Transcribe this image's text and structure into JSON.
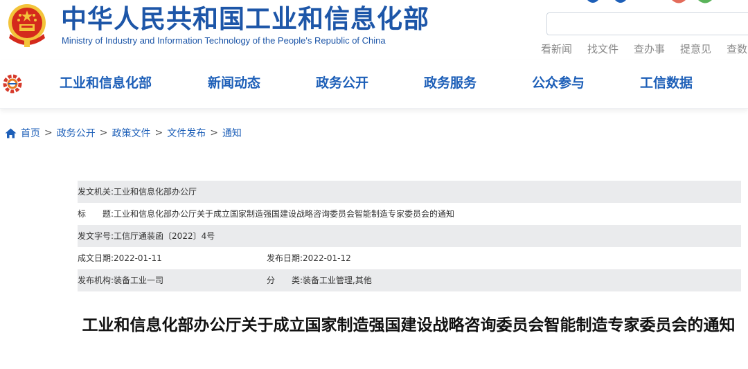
{
  "header": {
    "title_cn": "中华人民共和国工业和信息化部",
    "title_en": "Ministry of Industry and Information Technology of the People's Republic of China",
    "quick_links": [
      "看新闻",
      "找文件",
      "查办事",
      "提意见",
      "查数"
    ]
  },
  "nav": {
    "items": [
      "工业和信息化部",
      "新闻动态",
      "政务公开",
      "政务服务",
      "公众参与",
      "工信数据"
    ]
  },
  "breadcrumb": [
    "首页",
    "政务公开",
    "政策文件",
    "文件发布",
    "通知"
  ],
  "info": {
    "issuer_label": "发文机关:",
    "issuer": "工业和信息化部办公厅",
    "subject_label": "标　　题:",
    "subject": "工业和信息化部办公厅关于成立国家制造强国建设战略咨询委员会智能制造专家委员会的通知",
    "doc_no_label": "发文字号:",
    "doc_no": "工信厅通装函〔2022〕4号",
    "written_label": "成文日期:",
    "written": "2022-01-11",
    "published_label": "发布日期:",
    "published": "2022-01-12",
    "agency_label": "发布机构:",
    "agency": "装备工业一司",
    "category_label": "分　　类:",
    "category": "装备工业管理,其他"
  },
  "document": {
    "title": "工业和信息化部办公厅关于成立国家制造强国建设战略咨询委员会智能制造专家委员会的通知"
  },
  "colors": {
    "brand_blue": "#1d56a8",
    "nav_blue": "#1d5fb8",
    "emblem_red": "#d42a1c",
    "emblem_gold": "#f3c43a",
    "row_shade": "#eaebed"
  }
}
